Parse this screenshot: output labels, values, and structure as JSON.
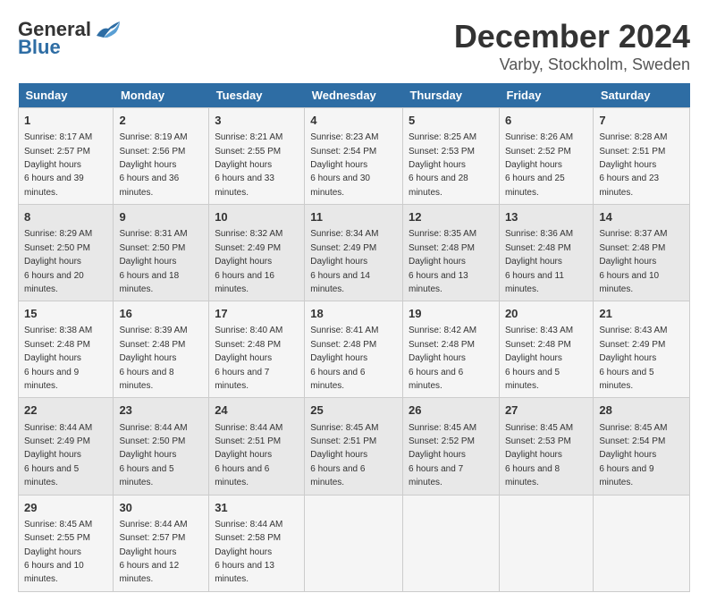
{
  "logo": {
    "text_general": "General",
    "text_blue": "Blue"
  },
  "title": "December 2024",
  "location": "Varby, Stockholm, Sweden",
  "weekdays": [
    "Sunday",
    "Monday",
    "Tuesday",
    "Wednesday",
    "Thursday",
    "Friday",
    "Saturday"
  ],
  "weeks": [
    [
      {
        "day": "1",
        "sunrise": "8:17 AM",
        "sunset": "2:57 PM",
        "daylight": "6 hours and 39 minutes."
      },
      {
        "day": "2",
        "sunrise": "8:19 AM",
        "sunset": "2:56 PM",
        "daylight": "6 hours and 36 minutes."
      },
      {
        "day": "3",
        "sunrise": "8:21 AM",
        "sunset": "2:55 PM",
        "daylight": "6 hours and 33 minutes."
      },
      {
        "day": "4",
        "sunrise": "8:23 AM",
        "sunset": "2:54 PM",
        "daylight": "6 hours and 30 minutes."
      },
      {
        "day": "5",
        "sunrise": "8:25 AM",
        "sunset": "2:53 PM",
        "daylight": "6 hours and 28 minutes."
      },
      {
        "day": "6",
        "sunrise": "8:26 AM",
        "sunset": "2:52 PM",
        "daylight": "6 hours and 25 minutes."
      },
      {
        "day": "7",
        "sunrise": "8:28 AM",
        "sunset": "2:51 PM",
        "daylight": "6 hours and 23 minutes."
      }
    ],
    [
      {
        "day": "8",
        "sunrise": "8:29 AM",
        "sunset": "2:50 PM",
        "daylight": "6 hours and 20 minutes."
      },
      {
        "day": "9",
        "sunrise": "8:31 AM",
        "sunset": "2:50 PM",
        "daylight": "6 hours and 18 minutes."
      },
      {
        "day": "10",
        "sunrise": "8:32 AM",
        "sunset": "2:49 PM",
        "daylight": "6 hours and 16 minutes."
      },
      {
        "day": "11",
        "sunrise": "8:34 AM",
        "sunset": "2:49 PM",
        "daylight": "6 hours and 14 minutes."
      },
      {
        "day": "12",
        "sunrise": "8:35 AM",
        "sunset": "2:48 PM",
        "daylight": "6 hours and 13 minutes."
      },
      {
        "day": "13",
        "sunrise": "8:36 AM",
        "sunset": "2:48 PM",
        "daylight": "6 hours and 11 minutes."
      },
      {
        "day": "14",
        "sunrise": "8:37 AM",
        "sunset": "2:48 PM",
        "daylight": "6 hours and 10 minutes."
      }
    ],
    [
      {
        "day": "15",
        "sunrise": "8:38 AM",
        "sunset": "2:48 PM",
        "daylight": "6 hours and 9 minutes."
      },
      {
        "day": "16",
        "sunrise": "8:39 AM",
        "sunset": "2:48 PM",
        "daylight": "6 hours and 8 minutes."
      },
      {
        "day": "17",
        "sunrise": "8:40 AM",
        "sunset": "2:48 PM",
        "daylight": "6 hours and 7 minutes."
      },
      {
        "day": "18",
        "sunrise": "8:41 AM",
        "sunset": "2:48 PM",
        "daylight": "6 hours and 6 minutes."
      },
      {
        "day": "19",
        "sunrise": "8:42 AM",
        "sunset": "2:48 PM",
        "daylight": "6 hours and 6 minutes."
      },
      {
        "day": "20",
        "sunrise": "8:43 AM",
        "sunset": "2:48 PM",
        "daylight": "6 hours and 5 minutes."
      },
      {
        "day": "21",
        "sunrise": "8:43 AM",
        "sunset": "2:49 PM",
        "daylight": "6 hours and 5 minutes."
      }
    ],
    [
      {
        "day": "22",
        "sunrise": "8:44 AM",
        "sunset": "2:49 PM",
        "daylight": "6 hours and 5 minutes."
      },
      {
        "day": "23",
        "sunrise": "8:44 AM",
        "sunset": "2:50 PM",
        "daylight": "6 hours and 5 minutes."
      },
      {
        "day": "24",
        "sunrise": "8:44 AM",
        "sunset": "2:51 PM",
        "daylight": "6 hours and 6 minutes."
      },
      {
        "day": "25",
        "sunrise": "8:45 AM",
        "sunset": "2:51 PM",
        "daylight": "6 hours and 6 minutes."
      },
      {
        "day": "26",
        "sunrise": "8:45 AM",
        "sunset": "2:52 PM",
        "daylight": "6 hours and 7 minutes."
      },
      {
        "day": "27",
        "sunrise": "8:45 AM",
        "sunset": "2:53 PM",
        "daylight": "6 hours and 8 minutes."
      },
      {
        "day": "28",
        "sunrise": "8:45 AM",
        "sunset": "2:54 PM",
        "daylight": "6 hours and 9 minutes."
      }
    ],
    [
      {
        "day": "29",
        "sunrise": "8:45 AM",
        "sunset": "2:55 PM",
        "daylight": "6 hours and 10 minutes."
      },
      {
        "day": "30",
        "sunrise": "8:44 AM",
        "sunset": "2:57 PM",
        "daylight": "6 hours and 12 minutes."
      },
      {
        "day": "31",
        "sunrise": "8:44 AM",
        "sunset": "2:58 PM",
        "daylight": "6 hours and 13 minutes."
      },
      null,
      null,
      null,
      null
    ]
  ]
}
